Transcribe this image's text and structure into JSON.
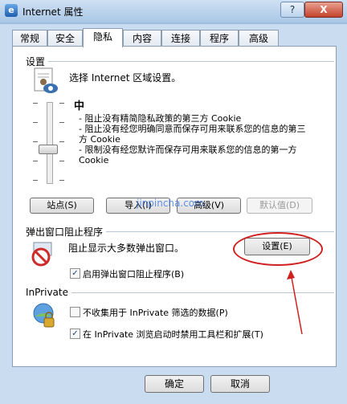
{
  "window": {
    "title": "Internet 属性",
    "help": "?",
    "close": "X"
  },
  "tabs": [
    "常规",
    "安全",
    "隐私",
    "内容",
    "连接",
    "程序",
    "高级"
  ],
  "active_tab": 2,
  "settings": {
    "group_label": "设置",
    "zone_prompt": "选择 Internet 区域设置。",
    "level": "中",
    "description": "- 阻止没有精简隐私政策的第三方 Cookie\n- 阻止没有经您明确同意而保存可用来联系您的信息的第三方 Cookie\n- 限制没有经您默许而保存可用来联系您的信息的第一方 Cookie",
    "buttons": {
      "sites": "站点(S)",
      "import": "导入(I)",
      "advanced": "高级(V)",
      "default": "默认值(D)"
    }
  },
  "popup": {
    "group_label": "弹出窗口阻止程序",
    "desc": "阻止显示大多数弹出窗口。",
    "settings_button": "设置(E)",
    "enable_label": "启用弹出窗口阻止程序(B)",
    "enable_checked": true
  },
  "inprivate": {
    "group_label": "InPrivate",
    "no_collect_label": "不收集用于 InPrivate 筛选的数据(P)",
    "no_collect_checked": false,
    "disable_label": "在 InPrivate 浏览启动时禁用工具栏和扩展(T)",
    "disable_checked": true
  },
  "footer": {
    "ok": "确定",
    "cancel": "取消"
  },
  "watermark": "jinpincha.com"
}
